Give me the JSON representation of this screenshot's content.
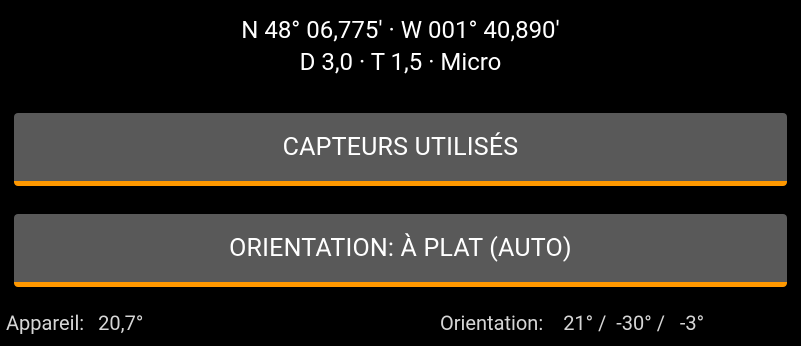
{
  "location": {
    "coordinates": "N 48° 06,775' · W 001° 40,890'",
    "details": "D 3,0 · T 1,5 · Micro"
  },
  "buttons": {
    "sensors_label": "CAPTEURS UTILISÉS",
    "orientation_label": "ORIENTATION: À PLAT (AUTO)"
  },
  "status": {
    "device_label": "Appareil:",
    "device_value": "20,7°",
    "orientation_label": "Orientation:",
    "orientation_value": "21° /  -30° /   -3°"
  },
  "colors": {
    "background": "#000000",
    "button": "#595959",
    "accent": "#ff9800",
    "text": "#ffffff",
    "status_text": "#d6d6d6"
  }
}
